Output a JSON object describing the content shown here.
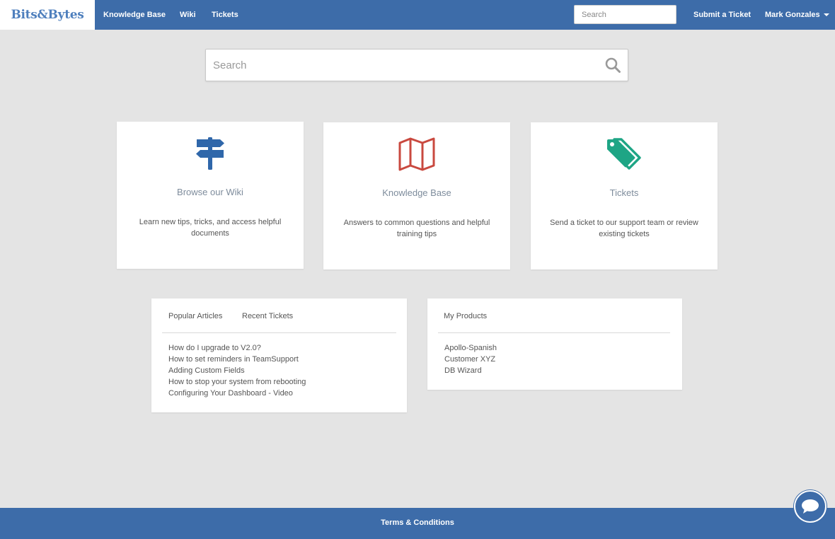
{
  "brand": {
    "name": "Bits&Bytes"
  },
  "nav": {
    "links": [
      "Knowledge Base",
      "Wiki",
      "Tickets"
    ],
    "search_placeholder": "Search",
    "submit_ticket": "Submit a Ticket",
    "user_name": "Mark Gonzales"
  },
  "main_search": {
    "placeholder": "Search"
  },
  "cards": [
    {
      "title": "Browse our Wiki",
      "description": "Learn new tips, tricks, and access helpful documents",
      "icon": "signpost-icon",
      "color": "#2f67aa"
    },
    {
      "title": "Knowledge Base",
      "description": "Answers to common questions and helpful training tips",
      "icon": "map-icon",
      "color": "#c9493f"
    },
    {
      "title": "Tickets",
      "description": "Send a ticket to our support team or review existing tickets",
      "icon": "tags-icon",
      "color": "#1ea585"
    }
  ],
  "articles_panel": {
    "tabs": [
      "Popular Articles",
      "Recent Tickets"
    ],
    "items": [
      "How do I upgrade to V2.0?",
      "How to set reminders in TeamSupport",
      "Adding Custom Fields",
      "How to stop your system from rebooting",
      "Configuring Your Dashboard - Video"
    ]
  },
  "products_panel": {
    "tabs": [
      "My Products"
    ],
    "items": [
      "Apollo-Spanish",
      "Customer XYZ",
      "DB Wizard"
    ]
  },
  "footer": {
    "link": "Terms & Conditions"
  },
  "chat": {
    "icon": "chat-bubble-icon"
  },
  "colors": {
    "primary": "#3d6ca9",
    "background": "#e4e4e4",
    "brand_text": "#4e7fbd"
  }
}
